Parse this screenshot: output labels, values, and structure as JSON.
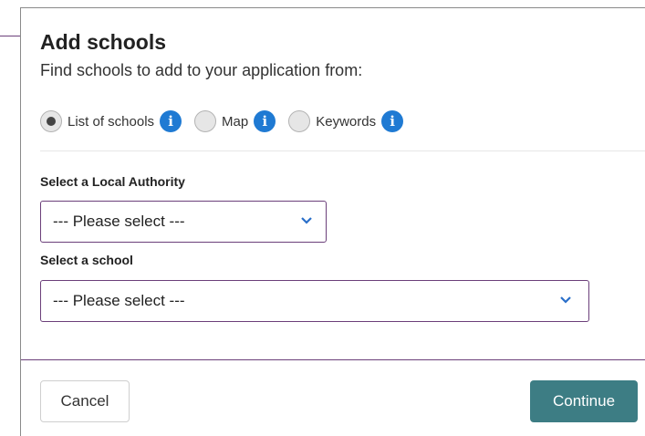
{
  "dialog": {
    "title": "Add schools",
    "subtitle": "Find schools to add to your application from:"
  },
  "search_modes": [
    {
      "label": "List of schools",
      "selected": true,
      "icon": "info-icon"
    },
    {
      "label": "Map",
      "selected": false,
      "icon": "info-icon"
    },
    {
      "label": "Keywords",
      "selected": false,
      "icon": "info-icon"
    }
  ],
  "local_authority": {
    "label": "Select a Local Authority",
    "value": "--- Please select ---"
  },
  "school": {
    "label": "Select a school",
    "value": "--- Please select ---"
  },
  "footer": {
    "cancel_label": "Cancel",
    "continue_label": "Continue"
  },
  "colors": {
    "accent": "#6b3f7a",
    "info": "#1f7ad3",
    "primary_button": "#3d7d84",
    "chevron": "#2a6fc9"
  }
}
